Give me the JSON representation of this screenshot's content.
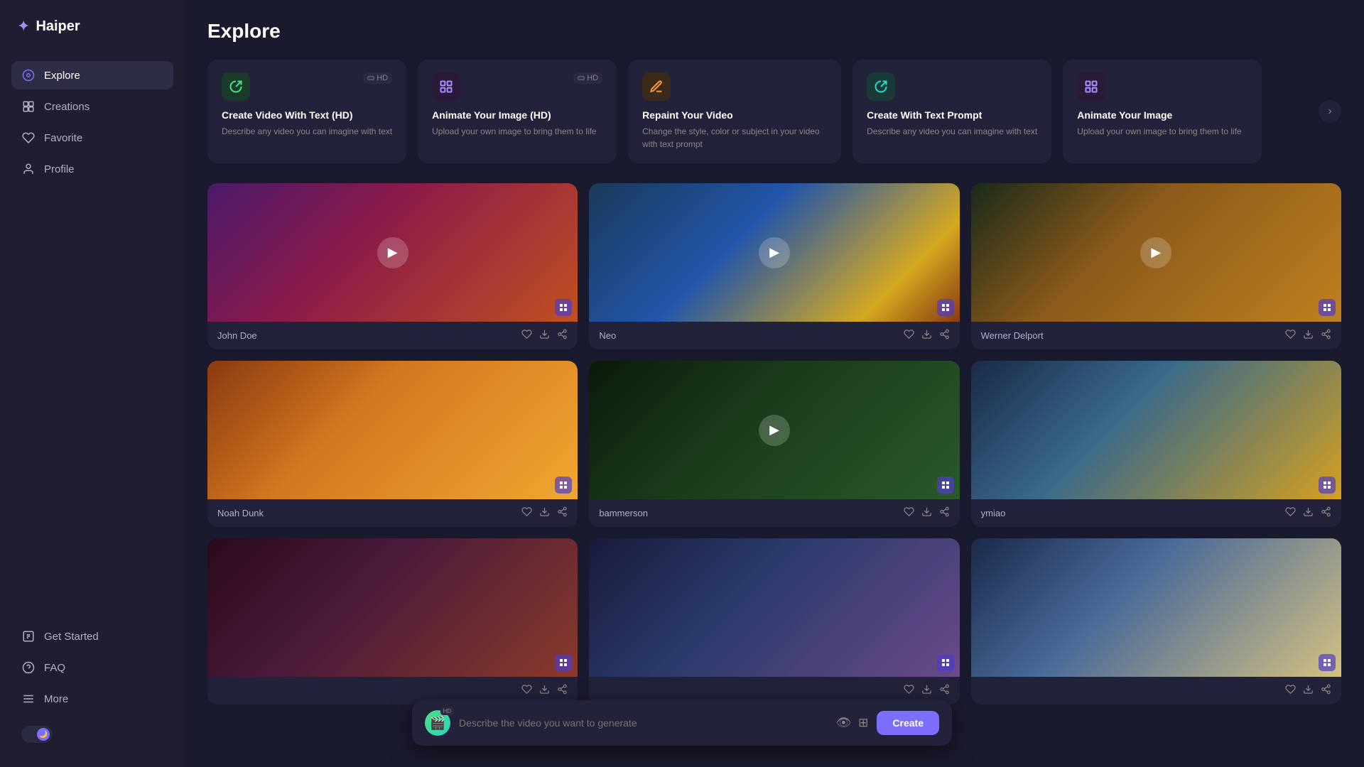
{
  "app": {
    "name": "Haiper",
    "logo_icon": "✦"
  },
  "sidebar": {
    "nav_items": [
      {
        "id": "explore",
        "label": "Explore",
        "icon": "⊙",
        "active": true
      },
      {
        "id": "creations",
        "label": "Creations",
        "icon": "⊞",
        "active": false
      },
      {
        "id": "favorite",
        "label": "Favorite",
        "icon": "♡",
        "active": false
      },
      {
        "id": "profile",
        "label": "Profile",
        "icon": "○",
        "active": false
      }
    ],
    "bottom_items": [
      {
        "id": "get-started",
        "label": "Get Started",
        "icon": "⊟"
      },
      {
        "id": "faq",
        "label": "FAQ",
        "icon": "⊙"
      },
      {
        "id": "more",
        "label": "More",
        "icon": "≡"
      }
    ],
    "toggle_icon": "🌙"
  },
  "page": {
    "title": "Explore"
  },
  "feature_cards": [
    {
      "id": "create-video-text-hd",
      "title": "Create Video With Text (HD)",
      "description": "Describe any video you can imagine with text",
      "icon": "↻",
      "icon_style": "green",
      "badge": "HD"
    },
    {
      "id": "animate-image-hd",
      "title": "Animate Your Image (HD)",
      "description": "Upload your own image to bring them to life",
      "icon": "⊞",
      "icon_style": "purple",
      "badge": "HD"
    },
    {
      "id": "repaint-video",
      "title": "Repaint Your Video",
      "description": "Change the style, color or subject in your video with text prompt",
      "icon": "✎",
      "icon_style": "orange",
      "badge": ""
    },
    {
      "id": "create-text-prompt",
      "title": "Create With Text Prompt",
      "description": "Describe any video you can imagine with text",
      "icon": "↻",
      "icon_style": "teal",
      "badge": ""
    },
    {
      "id": "animate-your-image",
      "title": "Animate Your Image",
      "description": "Upload your own image to bring them to life",
      "icon": "⊞",
      "icon_style": "purple",
      "badge": ""
    }
  ],
  "videos": [
    {
      "id": "v1",
      "author": "John Doe",
      "thumb_class": "thumb-1",
      "has_play": true
    },
    {
      "id": "v2",
      "author": "Neo",
      "thumb_class": "thumb-2",
      "has_play": true
    },
    {
      "id": "v3",
      "author": "Werner Delport",
      "thumb_class": "thumb-3",
      "has_play": true
    },
    {
      "id": "v4",
      "author": "Noah Dunk",
      "thumb_class": "thumb-4",
      "has_play": false
    },
    {
      "id": "v5",
      "author": "bammerson",
      "thumb_class": "thumb-5",
      "has_play": true
    },
    {
      "id": "v6",
      "author": "ymiao",
      "thumb_class": "thumb-6",
      "has_play": false
    },
    {
      "id": "v7",
      "author": "",
      "thumb_class": "thumb-7",
      "has_play": false
    },
    {
      "id": "v8",
      "author": "",
      "thumb_class": "thumb-8",
      "has_play": false
    },
    {
      "id": "v9",
      "author": "",
      "thumb_class": "thumb-9",
      "has_play": false
    }
  ],
  "prompt_bar": {
    "placeholder": "Describe the video you want to generate",
    "create_label": "Create",
    "badge": "HD"
  }
}
